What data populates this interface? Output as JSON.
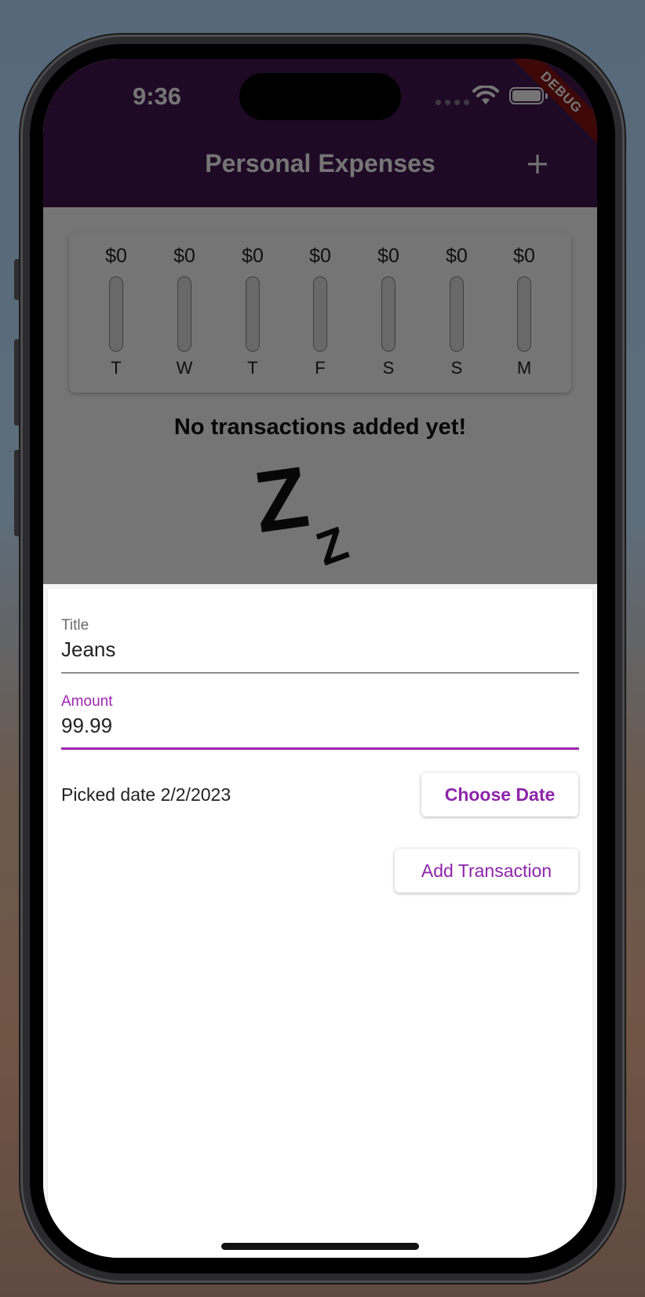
{
  "status_bar": {
    "time": "9:36"
  },
  "debug_label": "DEBUG",
  "app_bar": {
    "title": "Personal Expenses",
    "add_icon": "plus-icon",
    "color": "#431751"
  },
  "chart": {
    "bars": [
      {
        "amount": "$0",
        "day": "T"
      },
      {
        "amount": "$0",
        "day": "W"
      },
      {
        "amount": "$0",
        "day": "T"
      },
      {
        "amount": "$0",
        "day": "F"
      },
      {
        "amount": "$0",
        "day": "S"
      },
      {
        "amount": "$0",
        "day": "S"
      },
      {
        "amount": "$0",
        "day": "M"
      }
    ]
  },
  "empty_state": {
    "message": "No transactions added yet!",
    "icon": "sleeping-z-icon"
  },
  "form": {
    "title_label": "Title",
    "title_value": "Jeans",
    "amount_label": "Amount",
    "amount_value": "99.99",
    "picked_date_text": "Picked date 2/2/2023",
    "choose_date_label": "Choose Date",
    "add_transaction_label": "Add Transaction",
    "accent_color": "#9c27b0"
  }
}
